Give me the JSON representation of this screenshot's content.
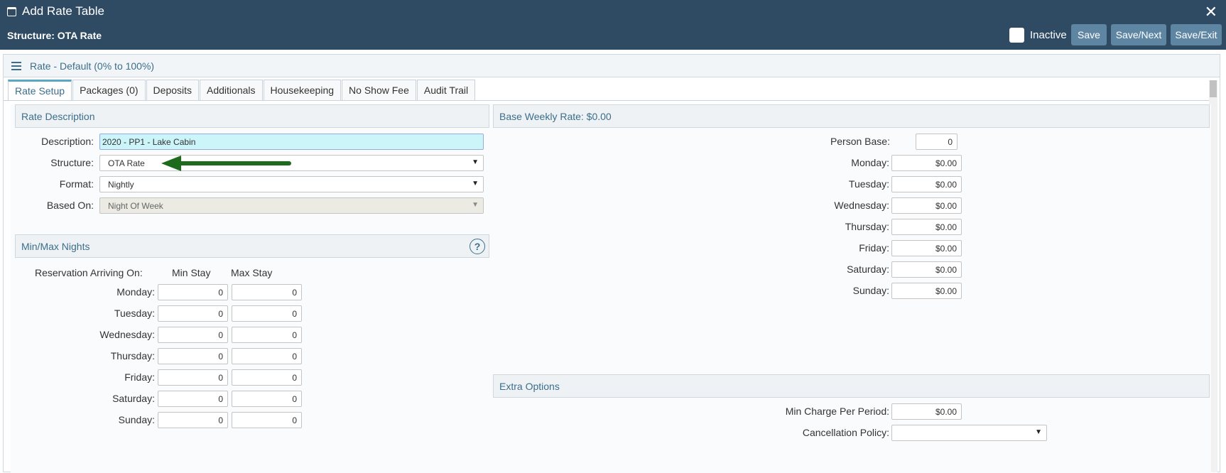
{
  "header": {
    "title": "Add Rate Table",
    "structure_text": "Structure: OTA Rate",
    "inactive_label": "Inactive",
    "buttons": {
      "save": "Save",
      "save_next": "Save/Next",
      "save_exit": "Save/Exit"
    },
    "close_glyph": "✕"
  },
  "subheader": {
    "text": "Rate - Default (0% to 100%)"
  },
  "tabs": [
    "Rate Setup",
    "Packages (0)",
    "Deposits",
    "Additionals",
    "Housekeeping",
    "No Show Fee",
    "Audit Trail"
  ],
  "rate_description": {
    "title": "Rate Description",
    "description_label": "Description:",
    "description_value": "2020 - PP1 - Lake Cabin",
    "structure_label": "Structure:",
    "structure_value": "OTA Rate",
    "format_label": "Format:",
    "format_value": "Nightly",
    "based_on_label": "Based On:",
    "based_on_value": "Night Of Week"
  },
  "min_max": {
    "title": "Min/Max Nights",
    "arriving_label": "Reservation Arriving On:",
    "min_stay_label": "Min Stay",
    "max_stay_label": "Max Stay",
    "days": [
      {
        "label": "Monday:",
        "min": "0",
        "max": "0"
      },
      {
        "label": "Tuesday:",
        "min": "0",
        "max": "0"
      },
      {
        "label": "Wednesday:",
        "min": "0",
        "max": "0"
      },
      {
        "label": "Thursday:",
        "min": "0",
        "max": "0"
      },
      {
        "label": "Friday:",
        "min": "0",
        "max": "0"
      },
      {
        "label": "Saturday:",
        "min": "0",
        "max": "0"
      },
      {
        "label": "Sunday:",
        "min": "0",
        "max": "0"
      }
    ]
  },
  "base_weekly": {
    "title": "Base Weekly Rate: $0.00",
    "person_base_label": "Person Base:",
    "person_base_value": "0",
    "days": [
      {
        "label": "Monday:",
        "value": "$0.00"
      },
      {
        "label": "Tuesday:",
        "value": "$0.00"
      },
      {
        "label": "Wednesday:",
        "value": "$0.00"
      },
      {
        "label": "Thursday:",
        "value": "$0.00"
      },
      {
        "label": "Friday:",
        "value": "$0.00"
      },
      {
        "label": "Saturday:",
        "value": "$0.00"
      },
      {
        "label": "Sunday:",
        "value": "$0.00"
      }
    ]
  },
  "extra_options": {
    "title": "Extra Options",
    "min_charge_label": "Min Charge Per Period:",
    "min_charge_value": "$0.00",
    "cancellation_label": "Cancellation Policy:",
    "cancellation_value": ""
  },
  "colors": {
    "header_bg": "#2f4b63",
    "button_bg": "#5e86a3",
    "accent": "#3c6e8a",
    "highlight_input": "#ccf5fa",
    "arrow": "#1e6b1e"
  }
}
